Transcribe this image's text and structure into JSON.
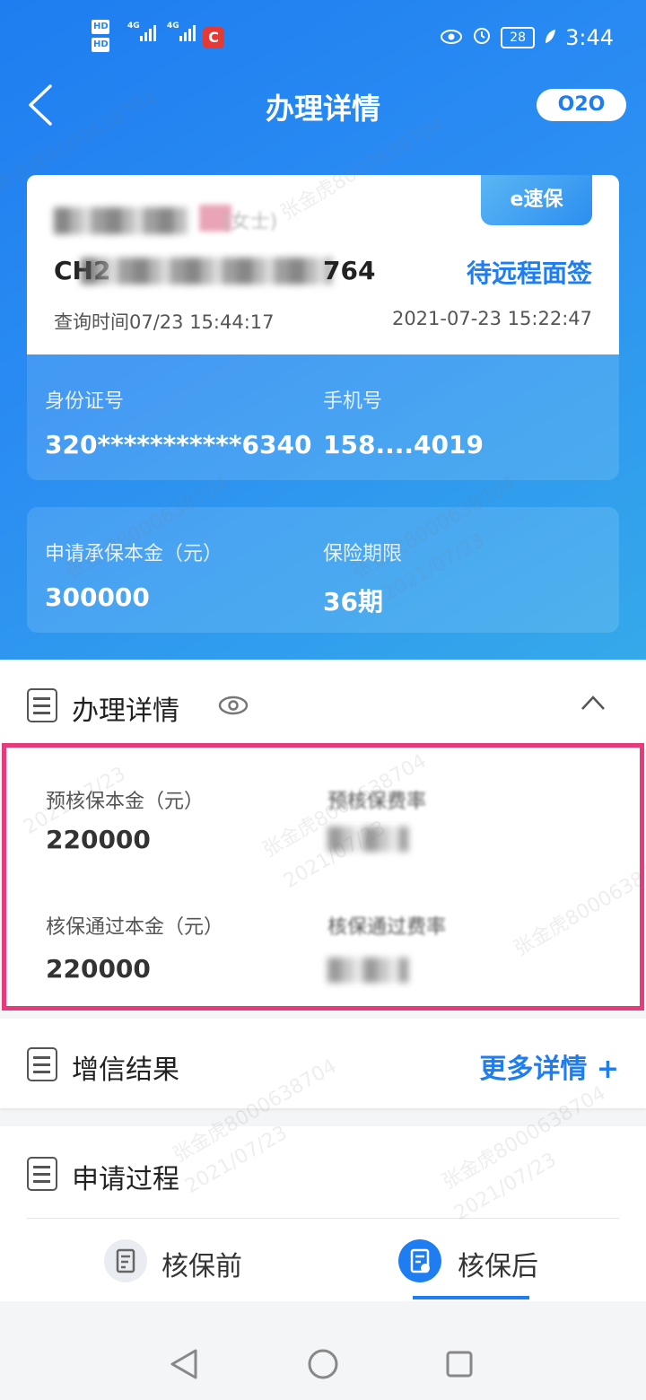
{
  "status_bar": {
    "hd1": "HD",
    "hd2": "HD",
    "net1": "4G",
    "net2": "4G",
    "app_badge": "C",
    "battery": "28",
    "time": "3:44"
  },
  "header": {
    "title": "办理详情",
    "badge": "O2O"
  },
  "card": {
    "tag": "e速保",
    "name_suffix": "(女士)",
    "order_head": "CH2",
    "order_tail": "764",
    "status": "待远程面签",
    "query_time": "查询时间07/23 15:44:17",
    "datetime": "2021-07-23 15:22:47"
  },
  "id_panel": {
    "id_label": "身份证号",
    "id_value": "320***********6340",
    "phone_label": "手机号",
    "phone_value": "158....4019"
  },
  "loan_panel": {
    "amount_label": "申请承保本金（元）",
    "amount_value": "300000",
    "term_label": "保险期限",
    "term_value": "36期"
  },
  "details": {
    "title": "办理详情",
    "pre_amount_label": "预核保本金（元）",
    "pre_amount_value": "220000",
    "pre_rate_label": "预核保费率",
    "pass_amount_label": "核保通过本金（元）",
    "pass_amount_value": "220000",
    "pass_rate_label": "核保通过费率"
  },
  "credit": {
    "title": "增信结果",
    "more": "更多详情 +"
  },
  "process": {
    "title": "申请过程",
    "tab_before": "核保前",
    "tab_after": "核保后"
  },
  "watermark": {
    "name": "张金虎8000638704",
    "date": "2021/07/23"
  },
  "colors": {
    "primary": "#1e7df0",
    "highlight_border": "#e63a7a"
  }
}
